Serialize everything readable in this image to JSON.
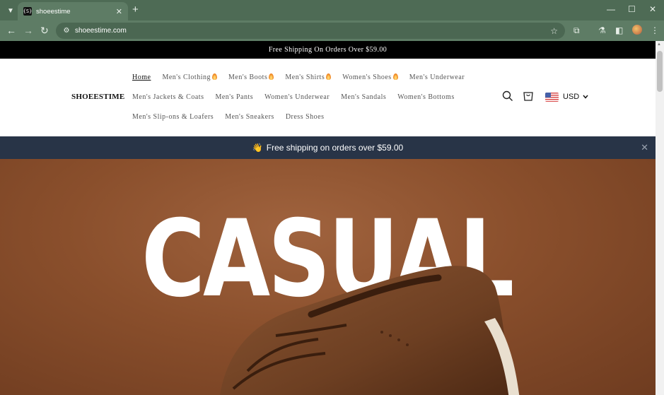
{
  "browser": {
    "tab_title": "shoeestime",
    "favicon_text": "{S}",
    "url": "shoeestime.com",
    "icons": {
      "tab_search": "chevron-down-icon",
      "new_tab": "plus-icon",
      "minimize": "minimize-icon",
      "maximize": "maximize-icon",
      "close": "close-icon",
      "back": "back-arrow-icon",
      "forward": "forward-arrow-icon",
      "reload": "reload-icon",
      "site_info": "site-info-icon",
      "bookmark": "star-icon",
      "extensions": "puzzle-icon",
      "labs": "flask-icon",
      "sidepanel": "sidepanel-icon",
      "menu": "kebab-menu-icon"
    }
  },
  "announcement": {
    "text": "Free Shipping On Orders Over $59.00"
  },
  "header": {
    "logo": "SHOEESTIME",
    "nav_rows": [
      [
        {
          "label": "Home",
          "active": true,
          "flame": false
        },
        {
          "label": "Men's Clothing",
          "active": false,
          "flame": true
        },
        {
          "label": "Men's Boots",
          "active": false,
          "flame": true
        },
        {
          "label": "Men's Shirts",
          "active": false,
          "flame": true
        },
        {
          "label": "Women's Shoes",
          "active": false,
          "flame": true
        },
        {
          "label": "Men's Underwear",
          "active": false,
          "flame": false
        }
      ],
      [
        {
          "label": "Men's Jackets & Coats",
          "active": false,
          "flame": false
        },
        {
          "label": "Men's Pants",
          "active": false,
          "flame": false
        },
        {
          "label": "Women's Underwear",
          "active": false,
          "flame": false
        },
        {
          "label": "Men's Sandals",
          "active": false,
          "flame": false
        },
        {
          "label": "Women's Bottoms",
          "active": false,
          "flame": false
        }
      ],
      [
        {
          "label": "Men's Slip-ons & Loafers",
          "active": false,
          "flame": false
        },
        {
          "label": "Men's Sneakers",
          "active": false,
          "flame": false
        },
        {
          "label": "Dress Shoes",
          "active": false,
          "flame": false
        }
      ]
    ],
    "currency": "USD",
    "icons": {
      "search": "search-icon",
      "cart": "cart-icon",
      "flag": "us-flag-icon",
      "dropdown": "chevron-down-icon"
    }
  },
  "promo": {
    "emoji": "👋",
    "text": "Free shipping on orders over $59.00"
  },
  "hero": {
    "headline": "CASUAL"
  },
  "colors": {
    "browser_frame": "#4e6b55",
    "announcement_bg": "#000000",
    "promo_bg": "#283447",
    "hero_bg": "#8a4f2c"
  }
}
